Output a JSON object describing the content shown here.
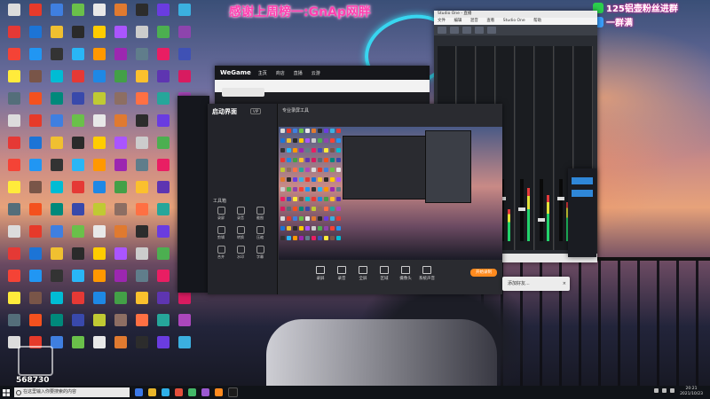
{
  "overlay": {
    "thanks_text": "感谢上周榜一:GnAp网胖",
    "wechat_line1": "125铝壶粉丝进群",
    "wechat_line2": "一群满",
    "viewer_count": "568730"
  },
  "desktop_icons": [
    {
      "label": "",
      "color": "#dcdcdc"
    },
    {
      "label": "",
      "color": "#e63a2a"
    },
    {
      "label": "",
      "color": "#3f7fe0"
    },
    {
      "label": "",
      "color": "#6ac04a"
    },
    {
      "label": "",
      "color": "#e8e8e8"
    },
    {
      "label": "",
      "color": "#e07a30"
    },
    {
      "label": "",
      "color": "#2c2c2c"
    },
    {
      "label": "",
      "color": "#6a3ce0"
    },
    {
      "label": "",
      "color": "#3bb0e0"
    },
    {
      "label": "",
      "color": "#e53935"
    },
    {
      "label": "",
      "color": "#1c74d6"
    },
    {
      "label": "",
      "color": "#f0c030"
    },
    {
      "label": "",
      "color": "#2a2a2a"
    },
    {
      "label": "",
      "color": "#ffcc00"
    },
    {
      "label": "",
      "color": "#aa55ff"
    },
    {
      "label": "",
      "color": "#cccccc"
    },
    {
      "label": "",
      "color": "#4caf50"
    },
    {
      "label": "",
      "color": "#8e44ad"
    },
    {
      "label": "",
      "color": "#f44336"
    },
    {
      "label": "",
      "color": "#2196f3"
    },
    {
      "label": "",
      "color": "#333333"
    },
    {
      "label": "",
      "color": "#29b6f6"
    },
    {
      "label": "",
      "color": "#ff9800"
    },
    {
      "label": "",
      "color": "#9c27b0"
    },
    {
      "label": "",
      "color": "#607d8b"
    },
    {
      "label": "",
      "color": "#e91e63"
    },
    {
      "label": "",
      "color": "#3f51b5"
    },
    {
      "label": "",
      "color": "#ffeb3b"
    },
    {
      "label": "",
      "color": "#795548"
    },
    {
      "label": "",
      "color": "#00bcd4"
    },
    {
      "label": "",
      "color": "#e53935"
    },
    {
      "label": "",
      "color": "#1e88e5"
    },
    {
      "label": "",
      "color": "#43a047"
    },
    {
      "label": "",
      "color": "#fbc02d"
    },
    {
      "label": "",
      "color": "#5e35b1"
    },
    {
      "label": "",
      "color": "#d81b60"
    },
    {
      "label": "",
      "color": "#546e7a"
    },
    {
      "label": "",
      "color": "#f4511e"
    },
    {
      "label": "",
      "color": "#00897b"
    },
    {
      "label": "",
      "color": "#3949ab"
    },
    {
      "label": "",
      "color": "#c0ca33"
    },
    {
      "label": "",
      "color": "#8d6e63"
    },
    {
      "label": "",
      "color": "#ff7043"
    },
    {
      "label": "",
      "color": "#26a69a"
    },
    {
      "label": "",
      "color": "#ab47bc"
    }
  ],
  "wegame": {
    "logo": "WeGame",
    "tabs": [
      "主页",
      "商店",
      "直播",
      "云游"
    ]
  },
  "studio": {
    "title": "Studio One - 直播",
    "menus": [
      "文件",
      "编辑",
      "混音",
      "查看",
      "Studio One",
      "帮助"
    ]
  },
  "luping": {
    "brand": "启动界面",
    "badge": "VIP",
    "hint": "专业录屏工具",
    "tools_title": "工具箱",
    "tools": [
      "录屏",
      "录音",
      "截图",
      "剪辑",
      "转换",
      "压缩",
      "合并",
      "水印",
      "字幕"
    ],
    "controls": [
      "录屏",
      "录音",
      "全屏",
      "区域",
      "摄像头",
      "系统声音"
    ],
    "start_label": "开始录制"
  },
  "notification": {
    "text": "添加好友..."
  },
  "taskbar": {
    "search_placeholder": "在这里输入你要搜索的内容",
    "time": "20:21",
    "date": "2021/10/23"
  }
}
